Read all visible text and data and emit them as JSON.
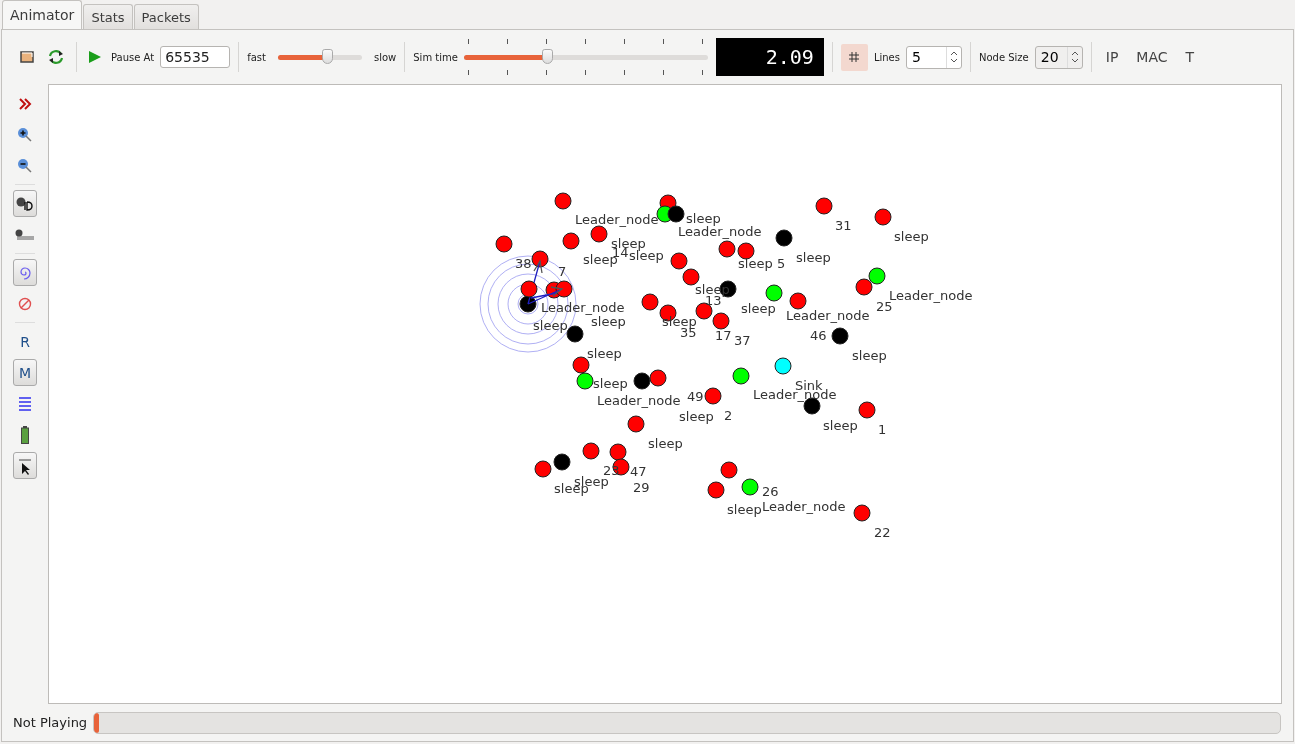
{
  "tabs": [
    {
      "label": "Animator",
      "selected": true
    },
    {
      "label": "Stats",
      "selected": false
    },
    {
      "label": "Packets",
      "selected": false
    }
  ],
  "toolbar": {
    "pause_label": "Pause At",
    "pause_value": "65535",
    "speed": {
      "min_label": "fast",
      "max_label": "slow",
      "level": 0.58
    },
    "sim_time": {
      "label": "Sim time",
      "level": 0.34
    },
    "time_display": "2.09",
    "grid": {
      "on": true
    },
    "lines": {
      "label": "Lines",
      "value": "5"
    },
    "node_size": {
      "label": "Node Size",
      "value": "20"
    },
    "text_buttons": [
      "IP",
      "MAC",
      "T"
    ]
  },
  "left_toolbar": [
    {
      "on": false
    },
    {
      "on": false
    },
    {
      "on": false
    },
    {
      "on": true
    },
    {
      "on": false
    },
    {
      "on": true
    },
    {
      "on": false
    },
    {
      "label": "R",
      "on": false
    },
    {
      "label": "M",
      "on": true
    },
    {
      "on": false
    },
    {
      "on": false
    },
    {
      "on": true
    }
  ],
  "nodes": [
    {
      "color": "#ff0000"
    },
    {
      "color": "#ff0000"
    },
    {
      "color": "#00ff00"
    },
    {
      "color": "#000000"
    },
    {
      "color": "#ff0000"
    },
    {
      "color": "#ff0000"
    },
    {
      "color": "#ff0000"
    },
    {
      "color": "#ff0000"
    },
    {
      "color": "#ff0000"
    },
    {
      "color": "#ff0000"
    },
    {
      "color": "#000000"
    },
    {
      "color": "#ff0000"
    },
    {
      "color": "#ff0000"
    },
    {
      "color": "#ff0000"
    },
    {
      "color": "#ff0000"
    },
    {
      "color": "#000000"
    },
    {
      "color": "#00ff00"
    },
    {
      "color": "#ff0000"
    },
    {
      "color": "#ff0000"
    },
    {
      "color": "#ff0000"
    },
    {
      "color": "#ff0000"
    },
    {
      "color": "#ff0000"
    },
    {
      "color": "#ff0000"
    },
    {
      "color": "#00ff00"
    },
    {
      "color": "#000000"
    },
    {
      "color": "#ff0000"
    },
    {
      "color": "#ff0000"
    },
    {
      "color": "#ff0000"
    },
    {
      "color": "#000000"
    },
    {
      "color": "#000000"
    },
    {
      "color": "#ff0000"
    },
    {
      "color": "#00ff00"
    },
    {
      "color": "#000000"
    },
    {
      "color": "#ff0000"
    },
    {
      "color": "#00ff00"
    },
    {
      "color": "#00ffff"
    },
    {
      "color": "#ff0000"
    },
    {
      "color": "#000000"
    },
    {
      "color": "#ff0000"
    },
    {
      "color": "#ff0000"
    },
    {
      "color": "#ff0000"
    },
    {
      "color": "#ff0000"
    },
    {
      "color": "#ff0000"
    },
    {
      "color": "#000000"
    },
    {
      "color": "#ff0000"
    },
    {
      "color": "#ff0000"
    },
    {
      "color": "#ff0000"
    },
    {
      "color": "#00ff00"
    },
    {
      "color": "#ff0000"
    }
  ],
  "node_labels": [
    "Leader_node",
    "sleep",
    "Leader_node",
    "sleep",
    "sleep",
    "14",
    "sleep",
    "sleep",
    "5",
    "sleep",
    "31",
    "sleep",
    "38",
    "7",
    "Leader_node",
    "sleep",
    "sleep",
    "sleep",
    "13",
    "sleep",
    "Leader_node",
    "25",
    "Leader_node",
    "sleep",
    "35",
    "17",
    "37",
    "46",
    "sleep",
    "sleep",
    "sleep",
    "Leader_node",
    "49",
    "sleep",
    "Sink",
    "Leader_node",
    "2",
    "sleep",
    "1",
    "sleep",
    "23",
    "47",
    "sleep",
    "sleep",
    "29",
    "26",
    "sleep",
    "Leader_node",
    "22"
  ],
  "status_bar": {
    "text": "Not Playing",
    "level": 0.004
  }
}
